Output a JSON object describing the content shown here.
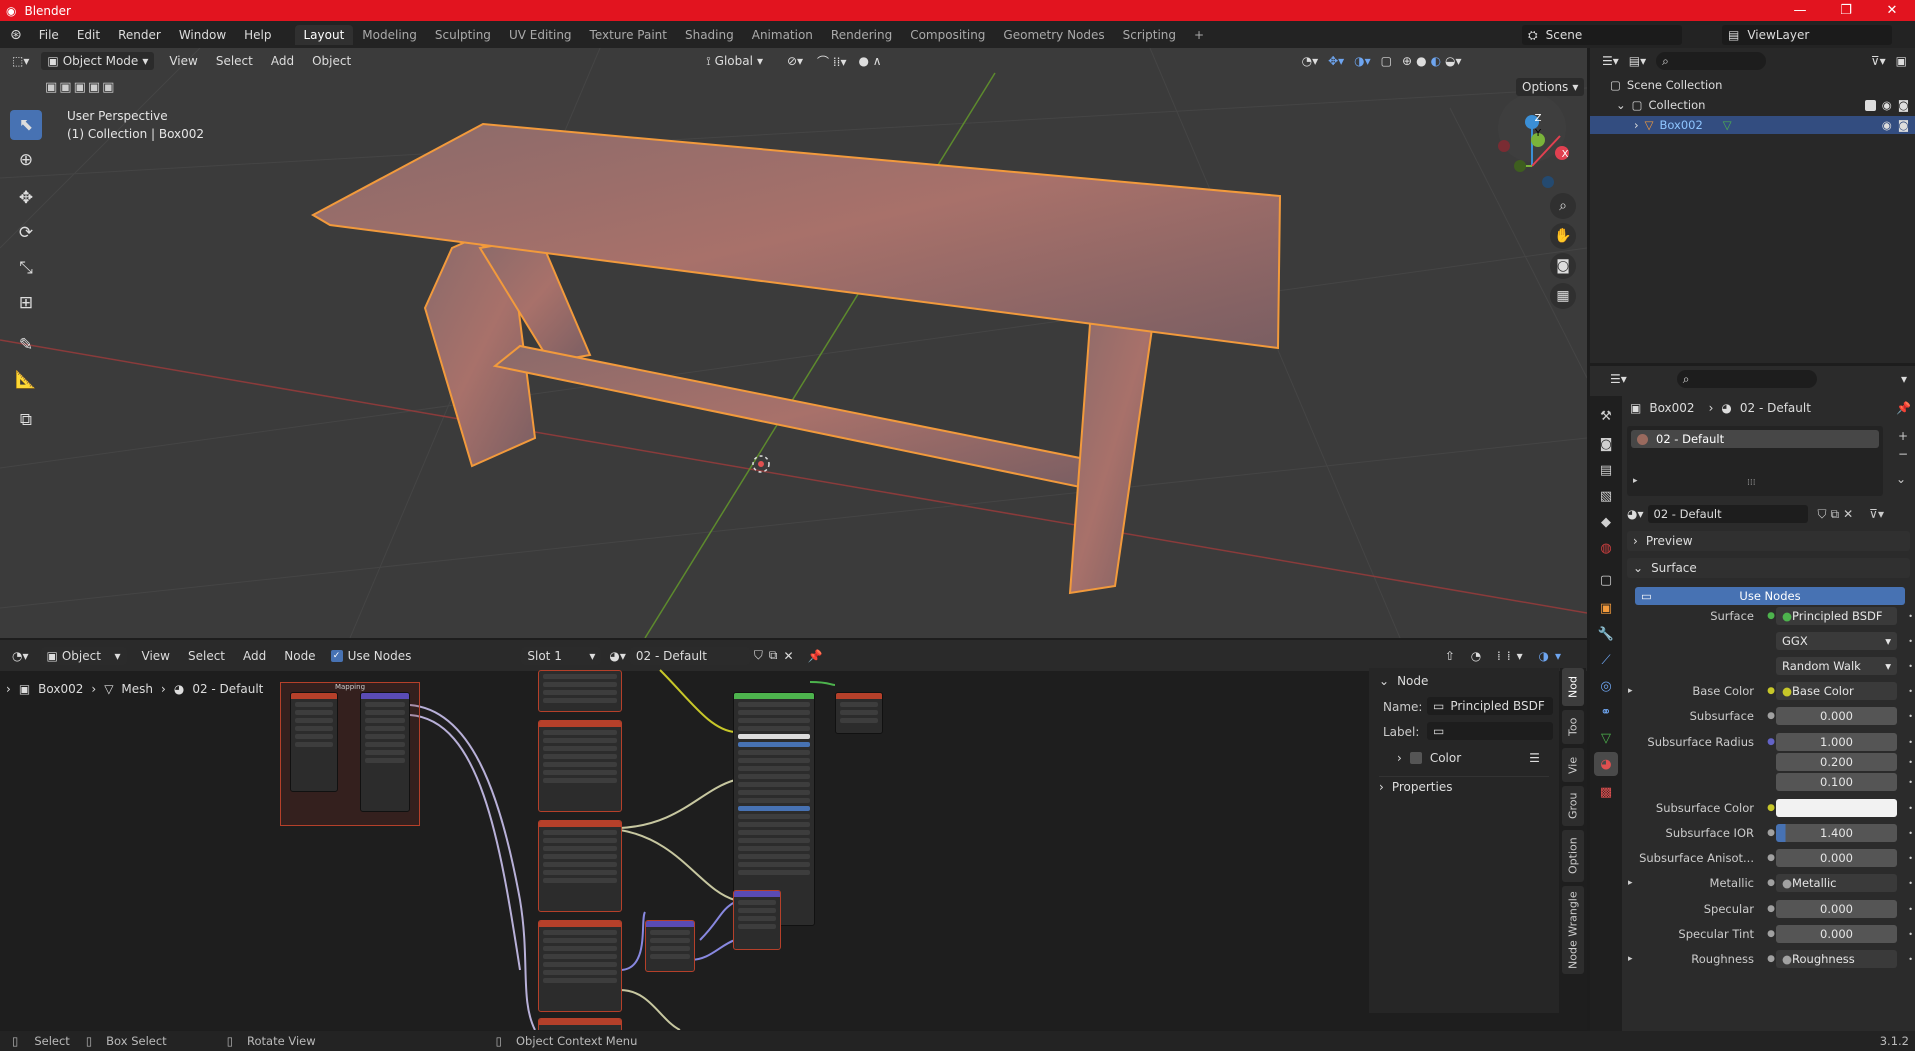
{
  "window": {
    "title": "Blender",
    "controls": [
      "—",
      "❐",
      "✕"
    ]
  },
  "menu": [
    "File",
    "Edit",
    "Render",
    "Window",
    "Help"
  ],
  "workspaces": [
    "Layout",
    "Modeling",
    "Sculpting",
    "UV Editing",
    "Texture Paint",
    "Shading",
    "Animation",
    "Rendering",
    "Compositing",
    "Geometry Nodes",
    "Scripting",
    "+"
  ],
  "active_workspace": "Layout",
  "scene": "Scene",
  "view_layer": "ViewLayer",
  "viewport": {
    "mode": "Object Mode",
    "menus": [
      "View",
      "Select",
      "Add",
      "Object"
    ],
    "orientation": "Global",
    "options": "Options",
    "info_line1": "User Perspective",
    "info_line2": "(1) Collection | Box002",
    "gizmo_axes": [
      "Z",
      "Y",
      "X"
    ]
  },
  "node_editor": {
    "type": "Object",
    "menus": [
      "View",
      "Select",
      "Add",
      "Node"
    ],
    "use_nodes": "Use Nodes",
    "slot": "Slot 1",
    "material": "02 - Default",
    "breadcrumb": [
      "Box002",
      "Mesh",
      "02 - Default"
    ],
    "frame_label": "Mapping",
    "panel": {
      "section_node": "Node",
      "name_label": "Name:",
      "name_value": "Principled BSDF",
      "label_label": "Label:",
      "label_value": "",
      "color": "Color",
      "properties": "Properties"
    },
    "side_tabs": [
      "Nod",
      "Too",
      "Vie",
      "Grou",
      "Option",
      "Node Wrangle"
    ]
  },
  "outliner": {
    "root": "Scene Collection",
    "collection": "Collection",
    "object": "Box002"
  },
  "properties": {
    "breadcrumb_object": "Box002",
    "breadcrumb_material": "02 - Default",
    "material_slot": "02 - Default",
    "material_name": "02 - Default",
    "preview": "Preview",
    "surface_section": "Surface",
    "use_nodes": "Use Nodes",
    "rows": [
      {
        "label": "Surface",
        "value": "Principled BSDF",
        "kind": "link",
        "dot": "#4db34d"
      },
      {
        "label": "",
        "value": "GGX",
        "kind": "dd"
      },
      {
        "label": "",
        "value": "Random Walk",
        "kind": "dd"
      },
      {
        "label": "Base Color",
        "value": "Base Color",
        "kind": "link",
        "dot": "#c7c729",
        "expand": true
      },
      {
        "label": "Subsurface",
        "value": "0.000",
        "kind": "num",
        "dot": "#a1a1a1"
      },
      {
        "label": "Subsurface Radius",
        "value": "1.000",
        "kind": "num",
        "dot": "#6363c7"
      },
      {
        "label": "",
        "value": "0.200",
        "kind": "num"
      },
      {
        "label": "",
        "value": "0.100",
        "kind": "num"
      },
      {
        "label": "Subsurface Color",
        "value": "",
        "kind": "color",
        "dot": "#c7c729"
      },
      {
        "label": "Subsurface IOR",
        "value": "1.400",
        "kind": "num",
        "dot": "#a1a1a1"
      },
      {
        "label": "Subsurface Anisot...",
        "value": "0.000",
        "kind": "num",
        "dot": "#a1a1a1"
      },
      {
        "label": "Metallic",
        "value": "Metallic",
        "kind": "link",
        "dot": "#a1a1a1",
        "expand": true
      },
      {
        "label": "Specular",
        "value": "0.000",
        "kind": "num",
        "dot": "#a1a1a1"
      },
      {
        "label": "Specular Tint",
        "value": "0.000",
        "kind": "num",
        "dot": "#a1a1a1"
      },
      {
        "label": "Roughness",
        "value": "Roughness",
        "kind": "link",
        "dot": "#a1a1a1",
        "expand": true
      }
    ]
  },
  "statusbar": {
    "select": "Select",
    "box_select": "Box Select",
    "rotate_view": "Rotate View",
    "context_menu": "Object Context Menu",
    "version": "3.1.2"
  },
  "colors": {
    "accent": "#4772b3",
    "selection": "#f29a3c",
    "titlebar": "#e2141f"
  }
}
